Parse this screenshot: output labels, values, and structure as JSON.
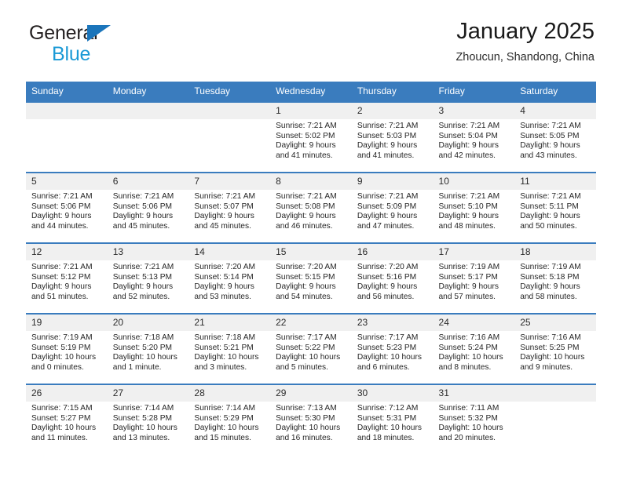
{
  "brand": {
    "line1": "General",
    "line2": "Blue",
    "triangle_color": "#1b75bb",
    "line2_color": "#1b9ad6"
  },
  "header": {
    "title": "January 2025",
    "subtitle": "Zhoucun, Shandong, China"
  },
  "theme": {
    "header_blue": "#3a7cbe",
    "daynum_bg": "#f0f0f0"
  },
  "weekday_headers": [
    "Sunday",
    "Monday",
    "Tuesday",
    "Wednesday",
    "Thursday",
    "Friday",
    "Saturday"
  ],
  "weeks": [
    [
      {
        "day": "",
        "details": ""
      },
      {
        "day": "",
        "details": ""
      },
      {
        "day": "",
        "details": ""
      },
      {
        "day": "1",
        "details": "Sunrise: 7:21 AM\nSunset: 5:02 PM\nDaylight: 9 hours\nand 41 minutes."
      },
      {
        "day": "2",
        "details": "Sunrise: 7:21 AM\nSunset: 5:03 PM\nDaylight: 9 hours\nand 41 minutes."
      },
      {
        "day": "3",
        "details": "Sunrise: 7:21 AM\nSunset: 5:04 PM\nDaylight: 9 hours\nand 42 minutes."
      },
      {
        "day": "4",
        "details": "Sunrise: 7:21 AM\nSunset: 5:05 PM\nDaylight: 9 hours\nand 43 minutes."
      }
    ],
    [
      {
        "day": "5",
        "details": "Sunrise: 7:21 AM\nSunset: 5:06 PM\nDaylight: 9 hours\nand 44 minutes."
      },
      {
        "day": "6",
        "details": "Sunrise: 7:21 AM\nSunset: 5:06 PM\nDaylight: 9 hours\nand 45 minutes."
      },
      {
        "day": "7",
        "details": "Sunrise: 7:21 AM\nSunset: 5:07 PM\nDaylight: 9 hours\nand 45 minutes."
      },
      {
        "day": "8",
        "details": "Sunrise: 7:21 AM\nSunset: 5:08 PM\nDaylight: 9 hours\nand 46 minutes."
      },
      {
        "day": "9",
        "details": "Sunrise: 7:21 AM\nSunset: 5:09 PM\nDaylight: 9 hours\nand 47 minutes."
      },
      {
        "day": "10",
        "details": "Sunrise: 7:21 AM\nSunset: 5:10 PM\nDaylight: 9 hours\nand 48 minutes."
      },
      {
        "day": "11",
        "details": "Sunrise: 7:21 AM\nSunset: 5:11 PM\nDaylight: 9 hours\nand 50 minutes."
      }
    ],
    [
      {
        "day": "12",
        "details": "Sunrise: 7:21 AM\nSunset: 5:12 PM\nDaylight: 9 hours\nand 51 minutes."
      },
      {
        "day": "13",
        "details": "Sunrise: 7:21 AM\nSunset: 5:13 PM\nDaylight: 9 hours\nand 52 minutes."
      },
      {
        "day": "14",
        "details": "Sunrise: 7:20 AM\nSunset: 5:14 PM\nDaylight: 9 hours\nand 53 minutes."
      },
      {
        "day": "15",
        "details": "Sunrise: 7:20 AM\nSunset: 5:15 PM\nDaylight: 9 hours\nand 54 minutes."
      },
      {
        "day": "16",
        "details": "Sunrise: 7:20 AM\nSunset: 5:16 PM\nDaylight: 9 hours\nand 56 minutes."
      },
      {
        "day": "17",
        "details": "Sunrise: 7:19 AM\nSunset: 5:17 PM\nDaylight: 9 hours\nand 57 minutes."
      },
      {
        "day": "18",
        "details": "Sunrise: 7:19 AM\nSunset: 5:18 PM\nDaylight: 9 hours\nand 58 minutes."
      }
    ],
    [
      {
        "day": "19",
        "details": "Sunrise: 7:19 AM\nSunset: 5:19 PM\nDaylight: 10 hours\nand 0 minutes."
      },
      {
        "day": "20",
        "details": "Sunrise: 7:18 AM\nSunset: 5:20 PM\nDaylight: 10 hours\nand 1 minute."
      },
      {
        "day": "21",
        "details": "Sunrise: 7:18 AM\nSunset: 5:21 PM\nDaylight: 10 hours\nand 3 minutes."
      },
      {
        "day": "22",
        "details": "Sunrise: 7:17 AM\nSunset: 5:22 PM\nDaylight: 10 hours\nand 5 minutes."
      },
      {
        "day": "23",
        "details": "Sunrise: 7:17 AM\nSunset: 5:23 PM\nDaylight: 10 hours\nand 6 minutes."
      },
      {
        "day": "24",
        "details": "Sunrise: 7:16 AM\nSunset: 5:24 PM\nDaylight: 10 hours\nand 8 minutes."
      },
      {
        "day": "25",
        "details": "Sunrise: 7:16 AM\nSunset: 5:25 PM\nDaylight: 10 hours\nand 9 minutes."
      }
    ],
    [
      {
        "day": "26",
        "details": "Sunrise: 7:15 AM\nSunset: 5:27 PM\nDaylight: 10 hours\nand 11 minutes."
      },
      {
        "day": "27",
        "details": "Sunrise: 7:14 AM\nSunset: 5:28 PM\nDaylight: 10 hours\nand 13 minutes."
      },
      {
        "day": "28",
        "details": "Sunrise: 7:14 AM\nSunset: 5:29 PM\nDaylight: 10 hours\nand 15 minutes."
      },
      {
        "day": "29",
        "details": "Sunrise: 7:13 AM\nSunset: 5:30 PM\nDaylight: 10 hours\nand 16 minutes."
      },
      {
        "day": "30",
        "details": "Sunrise: 7:12 AM\nSunset: 5:31 PM\nDaylight: 10 hours\nand 18 minutes."
      },
      {
        "day": "31",
        "details": "Sunrise: 7:11 AM\nSunset: 5:32 PM\nDaylight: 10 hours\nand 20 minutes."
      },
      {
        "day": "",
        "details": ""
      }
    ]
  ]
}
